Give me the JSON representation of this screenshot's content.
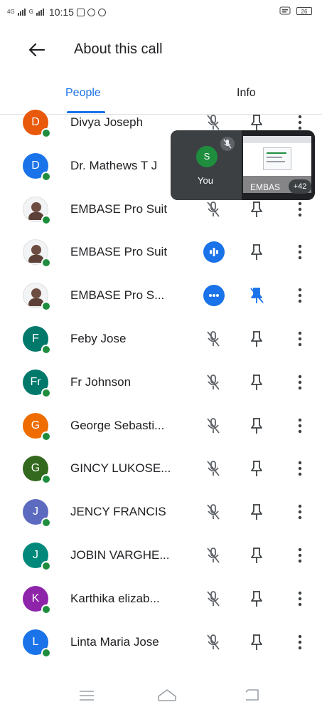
{
  "status_bar": {
    "signal_1": "4G",
    "signal_2": "G",
    "time": "10:15",
    "battery": "26"
  },
  "header": {
    "title": "About this call"
  },
  "tabs": [
    {
      "label": "People",
      "selected": true
    },
    {
      "label": "Info",
      "selected": false
    }
  ],
  "participants": [
    {
      "name": "Divya Joseph",
      "avatar": "D",
      "color": "#e8590c",
      "mic": "muted",
      "pinned": false
    },
    {
      "name": "Dr. Mathews T J",
      "avatar": "D",
      "color": "#1a73e8",
      "mic": "muted",
      "pinned": false
    },
    {
      "name": "EMBASE Pro Suit",
      "avatar": "photo",
      "color": "",
      "mic": "muted",
      "pinned": false
    },
    {
      "name": "EMBASE Pro Suit",
      "avatar": "photo",
      "color": "",
      "mic": "speaking",
      "pinned": false
    },
    {
      "name": "EMBASE Pro S...",
      "avatar": "photo",
      "color": "",
      "mic": "presenting",
      "pinned": true
    },
    {
      "name": "Feby Jose",
      "avatar": "F",
      "color": "#00796b",
      "mic": "muted",
      "pinned": false
    },
    {
      "name": "Fr Johnson",
      "avatar": "Fr",
      "color": "#00796b",
      "mic": "muted",
      "pinned": false
    },
    {
      "name": "George Sebasti...",
      "avatar": "G",
      "color": "#ef6c00",
      "mic": "muted",
      "pinned": false
    },
    {
      "name": "GINCY LUKOSE...",
      "avatar": "G",
      "color": "#33691e",
      "mic": "muted",
      "pinned": false
    },
    {
      "name": "JENCY FRANCIS",
      "avatar": "J",
      "color": "#5c6bc0",
      "mic": "muted",
      "pinned": false
    },
    {
      "name": "JOBIN VARGHE...",
      "avatar": "J",
      "color": "#00897b",
      "mic": "muted",
      "pinned": false
    },
    {
      "name": "Karthika elizab...",
      "avatar": "K",
      "color": "#8e24aa",
      "mic": "muted",
      "pinned": false
    },
    {
      "name": "Linta Maria Jose",
      "avatar": "L",
      "color": "#1a73e8",
      "mic": "muted",
      "pinned": false
    }
  ],
  "pip": {
    "self_avatar": "S",
    "self_label": "You",
    "screen_label": "EMBAS",
    "overflow_count": "+42"
  },
  "colors": {
    "accent": "#1a73e8",
    "online": "#1e8e3e",
    "icon": "#5f6368"
  }
}
